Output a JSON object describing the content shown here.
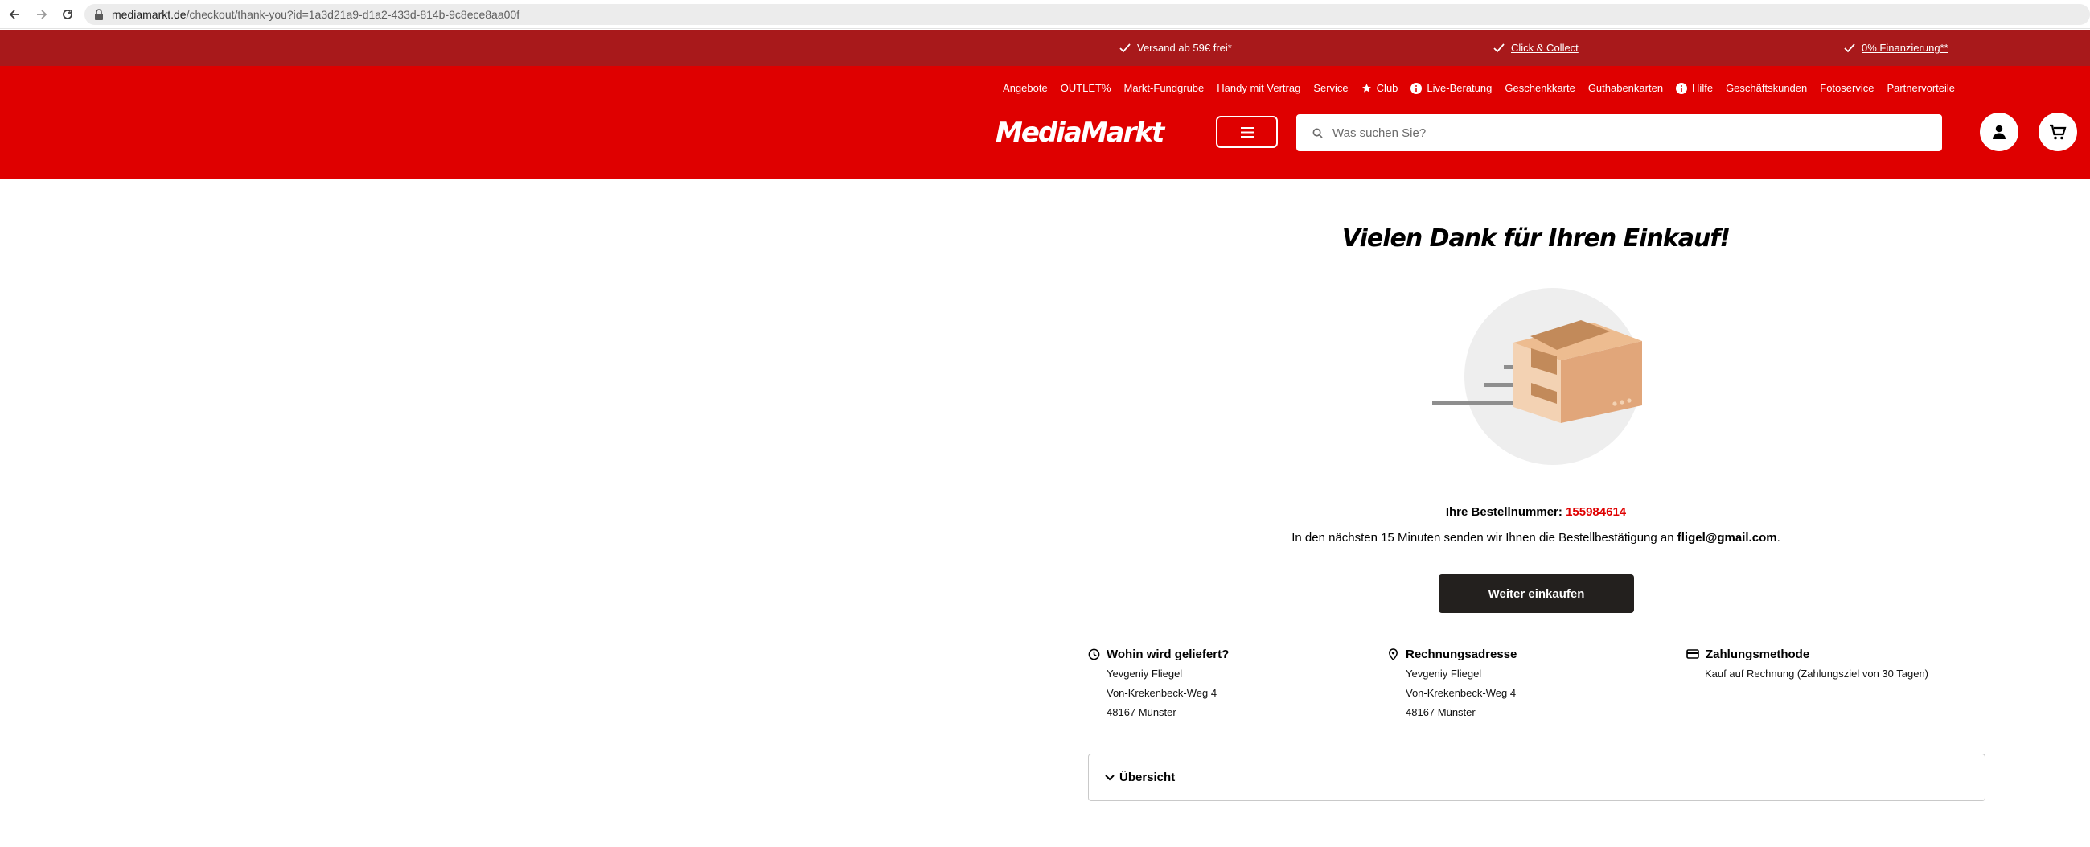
{
  "browser": {
    "url_host": "mediamarkt.de",
    "url_path": "/checkout/thank-you?id=1a3d21a9-d1a2-433d-814b-9c8ece8aa00f"
  },
  "promo": {
    "items": [
      {
        "label": "Versand ab 59€ frei*"
      },
      {
        "label": "Click & Collect"
      },
      {
        "label": "0% Finanzierung**"
      }
    ]
  },
  "nav": {
    "items": [
      {
        "label": "Angebote"
      },
      {
        "label": "OUTLET%"
      },
      {
        "label": "Markt-Fundgrube"
      },
      {
        "label": "Handy mit Vertrag"
      },
      {
        "label": "Service"
      },
      {
        "label": "Club"
      },
      {
        "label": "Live-Beratung"
      },
      {
        "label": "Geschenkkarte"
      },
      {
        "label": "Guthabenkarten"
      },
      {
        "label": "Hilfe"
      },
      {
        "label": "Geschäftskunden"
      },
      {
        "label": "Fotoservice"
      },
      {
        "label": "Partnervorteile"
      }
    ]
  },
  "header": {
    "logo_text": "MediaMarkt",
    "search_placeholder": "Was suchen Sie?"
  },
  "main": {
    "title": "Vielen Dank für Ihren Einkauf!",
    "order_label": "Ihre Bestellnummer:",
    "order_number": "155984614",
    "confirm_text": "In den nächsten 15 Minuten senden wir Ihnen die Bestellbestätigung an",
    "email": "fligel@gmail.com",
    "confirm_end": ".",
    "continue_label": "Weiter einkaufen"
  },
  "info": {
    "delivery": {
      "title": "Wohin wird geliefert?",
      "name": "Yevgeniy Fliegel",
      "street": "Von-Krekenbeck-Weg 4",
      "city": "48167 Münster"
    },
    "billing": {
      "title": "Rechnungsadresse",
      "name": "Yevgeniy Fliegel",
      "street": "Von-Krekenbeck-Weg 4",
      "city": "48167 Münster"
    },
    "payment": {
      "title": "Zahlungsmethode",
      "method": "Kauf auf Rechnung (Zahlungsziel von 30 Tagen)"
    }
  },
  "overview": {
    "label": "Übersicht"
  },
  "colors": {
    "brand_red": "#df0000",
    "promo_red": "#a8191b",
    "button_dark": "#23201e"
  }
}
